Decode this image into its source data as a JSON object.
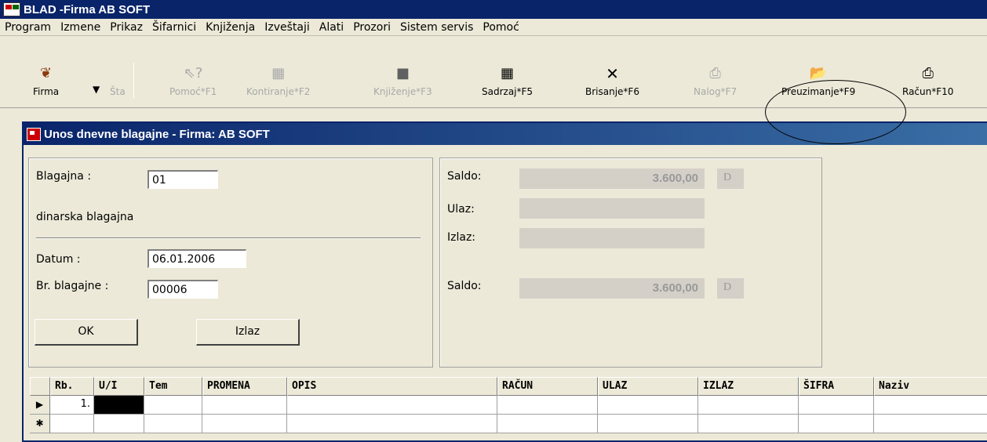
{
  "app": {
    "title": "BLAD -Firma AB SOFT"
  },
  "menu": [
    "Program",
    "Izmene",
    "Prikaz",
    "Šifarnici",
    "Knjiženja",
    "Izveštaji",
    "Alati",
    "Prozori",
    "Sistem servis",
    "Pomoć"
  ],
  "toolbar": {
    "firma": "Firma",
    "sta": "Šta",
    "pomoc": "Pomoć*F1",
    "kontiranje": "Kontiranje*F2",
    "knjizenje": "Knjiženje*F3",
    "sadrzaj": "Sadrzaj*F5",
    "brisanje": "Brisanje*F6",
    "nalog": "Nalog*F7",
    "preuzimanje": "Preuzimanje*F9",
    "racun": "Račun*F10"
  },
  "window": {
    "title": "Unos dnevne blagajne - Firma: AB SOFT"
  },
  "form": {
    "blagajna_label": "Blagajna :",
    "blagajna_value": "01",
    "blagajna_desc": "dinarska blagajna",
    "datum_label": "Datum :",
    "datum_value": "06.01.2006",
    "br_label": "Br. blagajne :",
    "br_value": "00006",
    "ok_label": "OK",
    "izlaz_label": "Izlaz"
  },
  "summary": {
    "saldo_label": "Saldo:",
    "saldo_start": "3.600,00",
    "saldo_start_dc": "D",
    "ulaz_label": "Ulaz:",
    "ulaz_value": "",
    "izlaz_label": "Izlaz:",
    "izlaz_value": "",
    "saldo_end": "3.600,00",
    "saldo_end_dc": "D"
  },
  "grid": {
    "columns": [
      "Rb.",
      "U/I",
      "Tem",
      "PROMENA",
      "OPIS",
      "RAČUN",
      "ULAZ",
      "IZLAZ",
      "ŠIFRA",
      "Naziv"
    ],
    "rows": [
      {
        "rb": "1."
      }
    ],
    "current_marker": "▶",
    "new_marker": "✱"
  }
}
